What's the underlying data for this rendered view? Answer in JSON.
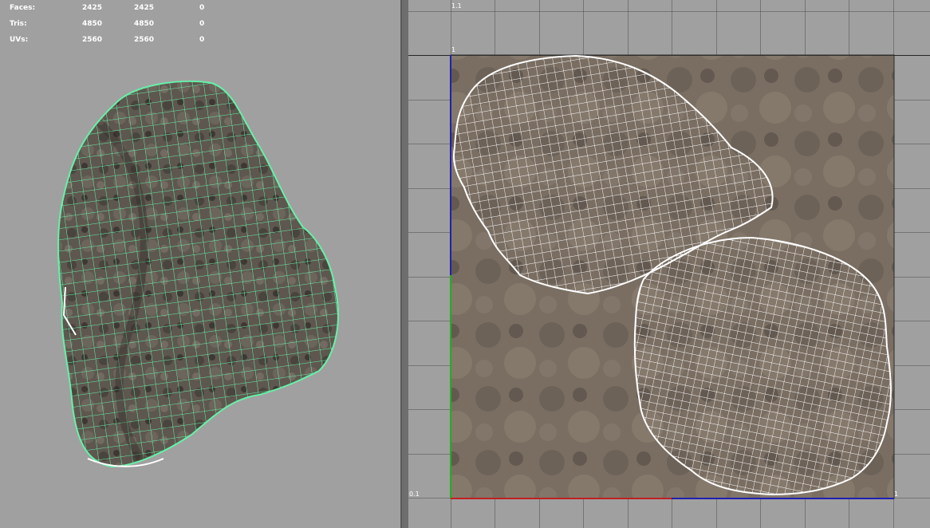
{
  "stats": {
    "rows": [
      {
        "label": "Faces:",
        "a": "2425",
        "b": "2425",
        "c": "0"
      },
      {
        "label": "Tris:",
        "a": "4850",
        "b": "4850",
        "c": "0"
      },
      {
        "label": "UVs:",
        "a": "2560",
        "b": "2560",
        "c": "0"
      }
    ]
  },
  "uv_editor": {
    "label_top_left": "1.1",
    "label_tile_top": "1",
    "label_bottom_left": "0.1",
    "label_bottom_right": "1"
  },
  "colors": {
    "viewport_bg": "#a0a0a0",
    "wire_selected": "#66f0a8",
    "uv_wire": "#ffffff",
    "texture_base": "#7a6e62",
    "grid_line": "#3a3a3a",
    "axis_u": "#c02020",
    "axis_v": "#20b020",
    "axis_blue": "#2020b0"
  }
}
